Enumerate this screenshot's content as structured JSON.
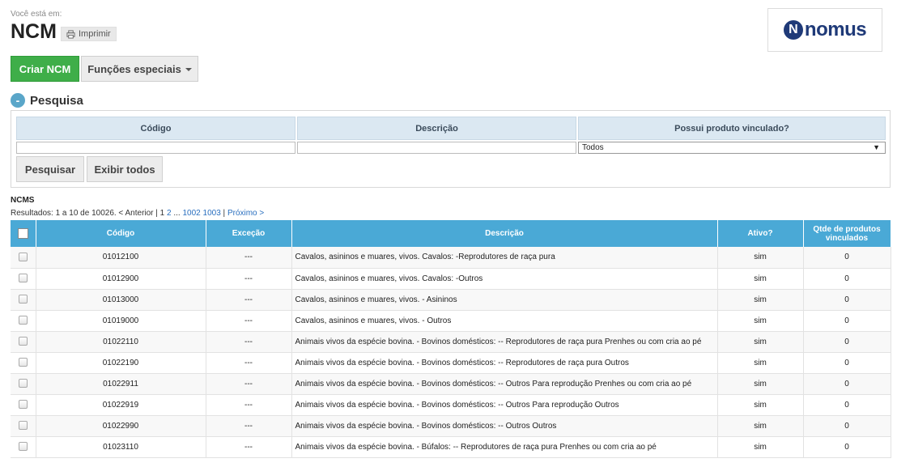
{
  "breadcrumb": {
    "label": "Você está em:"
  },
  "page": {
    "title": "NCM",
    "print_label": "Imprimir"
  },
  "logo": {
    "text": "nomus",
    "mark": "N"
  },
  "toolbar": {
    "create_label": "Criar NCM",
    "special_label": "Funções especiais"
  },
  "search": {
    "title": "Pesquisa",
    "collapse_symbol": "-",
    "headers": {
      "codigo": "Código",
      "descricao": "Descrição",
      "vinculado": "Possui produto vinculado?"
    },
    "codigo_value": "",
    "descricao_value": "",
    "vinculado_value": "Todos",
    "search_button": "Pesquisar",
    "show_all_button": "Exibir todos"
  },
  "results": {
    "section_title": "NCMS",
    "summary": "Resultados: 1 a 10 de 10026. < Anterior | 1",
    "page_2": "2",
    "ellipsis": "...",
    "page_1002": "1002",
    "page_1003": "1003",
    "separator": "|",
    "next": "Próximo >"
  },
  "table": {
    "columns": [
      "Código",
      "Exceção",
      "Descrição",
      "Ativo?",
      "Qtde de produtos vinculados"
    ],
    "rows": [
      {
        "codigo": "01012100",
        "excecao": "---",
        "descricao": "Cavalos, asininos e muares, vivos. Cavalos: -Reprodutores de raça pura",
        "ativo": "sim",
        "qtde": "0"
      },
      {
        "codigo": "01012900",
        "excecao": "---",
        "descricao": "Cavalos, asininos e muares, vivos. Cavalos: -Outros",
        "ativo": "sim",
        "qtde": "0"
      },
      {
        "codigo": "01013000",
        "excecao": "---",
        "descricao": "Cavalos, asininos e muares, vivos. - Asininos",
        "ativo": "sim",
        "qtde": "0"
      },
      {
        "codigo": "01019000",
        "excecao": "---",
        "descricao": "Cavalos, asininos e muares, vivos. - Outros",
        "ativo": "sim",
        "qtde": "0"
      },
      {
        "codigo": "01022110",
        "excecao": "---",
        "descricao": "Animais vivos da espécie bovina. - Bovinos domésticos: -- Reprodutores de raça pura Prenhes ou com cria ao pé",
        "ativo": "sim",
        "qtde": "0"
      },
      {
        "codigo": "01022190",
        "excecao": "---",
        "descricao": "Animais vivos da espécie bovina. - Bovinos domésticos: -- Reprodutores de raça pura Outros",
        "ativo": "sim",
        "qtde": "0"
      },
      {
        "codigo": "01022911",
        "excecao": "---",
        "descricao": "Animais vivos da espécie bovina. - Bovinos domésticos: -- Outros Para reprodução Prenhes ou com cria ao pé",
        "ativo": "sim",
        "qtde": "0"
      },
      {
        "codigo": "01022919",
        "excecao": "---",
        "descricao": "Animais vivos da espécie bovina. - Bovinos domésticos: -- Outros Para reprodução Outros",
        "ativo": "sim",
        "qtde": "0"
      },
      {
        "codigo": "01022990",
        "excecao": "---",
        "descricao": "Animais vivos da espécie bovina. - Bovinos domésticos: -- Outros Outros",
        "ativo": "sim",
        "qtde": "0"
      },
      {
        "codigo": "01023110",
        "excecao": "---",
        "descricao": "Animais vivos da espécie bovina. - Búfalos: -- Reprodutores de raça pura Prenhes ou com cria ao pé",
        "ativo": "sim",
        "qtde": "0"
      }
    ]
  },
  "colors": {
    "accent_green": "#3fae49",
    "header_blue": "#4aa9d6",
    "link_blue": "#2a6fbf",
    "logo_navy": "#1f3a78"
  },
  "icons": {
    "print": "printer-icon",
    "collapse": "collapse-icon",
    "dropdown": "caret-down-icon"
  }
}
